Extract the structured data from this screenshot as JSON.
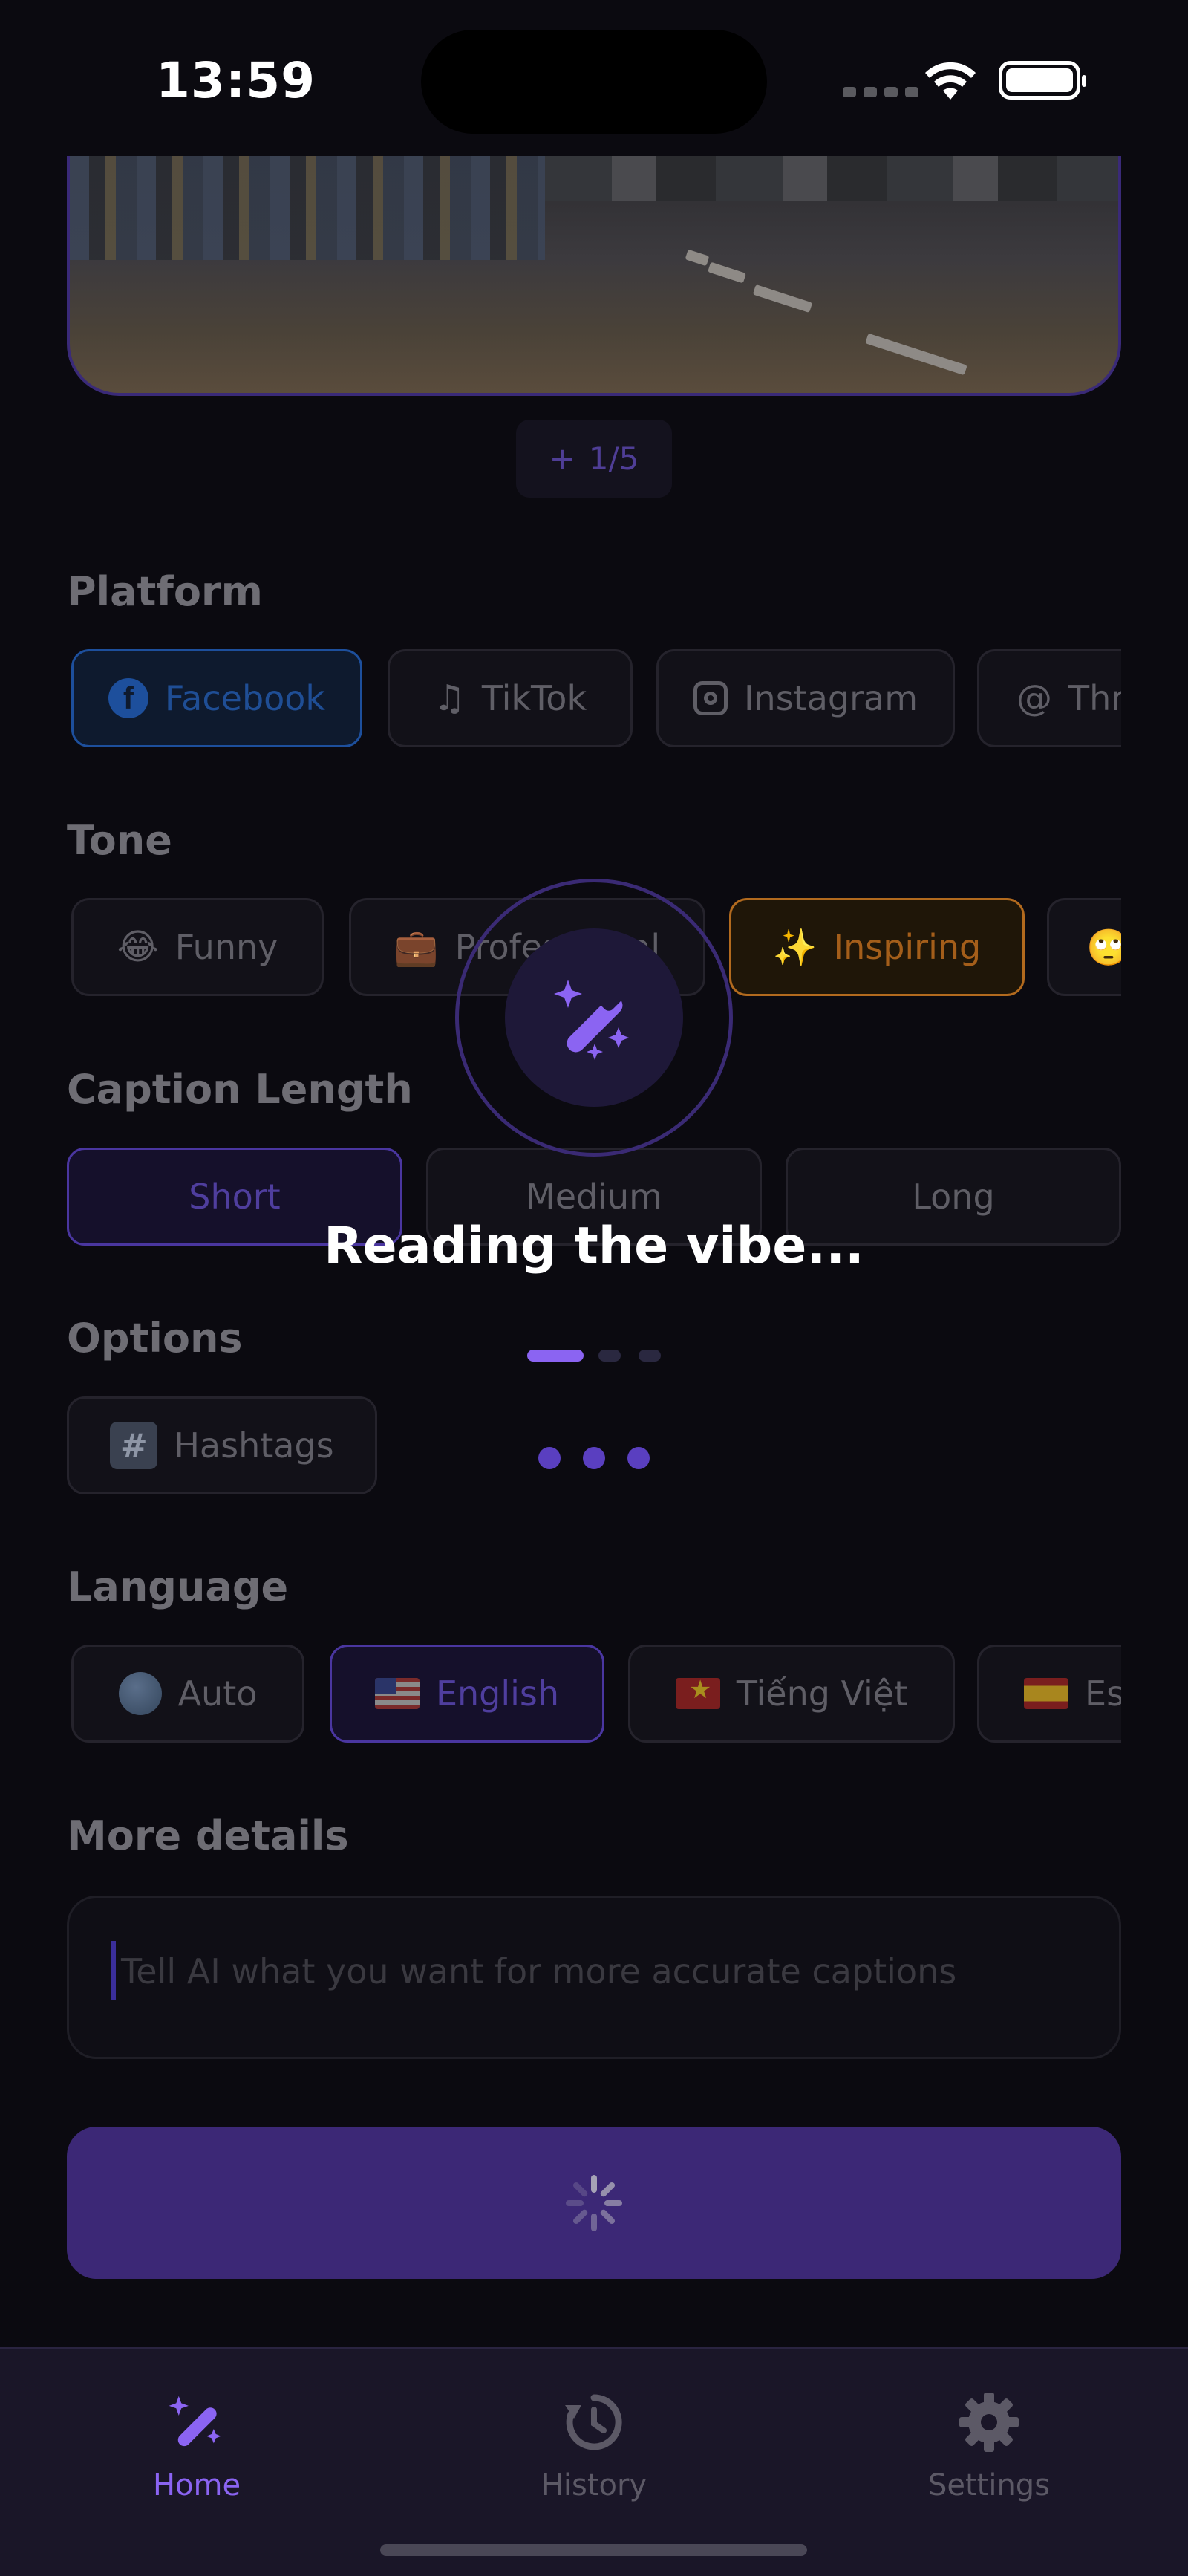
{
  "status_bar": {
    "time": "13:59"
  },
  "photo": {
    "counter": "1/5"
  },
  "sections": {
    "platform": "Platform",
    "tone": "Tone",
    "caption_length": "Caption Length",
    "options": "Options",
    "language": "Language",
    "more_details": "More details"
  },
  "platforms": [
    {
      "label": "Facebook",
      "icon": "facebook-icon",
      "selected": true
    },
    {
      "label": "TikTok",
      "icon": "music-note-icon",
      "selected": false
    },
    {
      "label": "Instagram",
      "icon": "instagram-icon",
      "selected": false
    },
    {
      "label": "Thr",
      "icon": "at-sign-icon",
      "selected": false
    }
  ],
  "tones": [
    {
      "label": "Funny",
      "emoji": "😂",
      "selected": false
    },
    {
      "label": "Professional",
      "emoji": "💼",
      "selected": false
    },
    {
      "label": "Inspiring",
      "emoji": "✨",
      "selected": true
    },
    {
      "label": "",
      "emoji": "🙄",
      "selected": false
    }
  ],
  "lengths": [
    {
      "label": "Short",
      "selected": true
    },
    {
      "label": "Medium",
      "selected": false
    },
    {
      "label": "Long",
      "selected": false
    }
  ],
  "options": [
    {
      "label": "Hashtags",
      "icon": "hash-icon",
      "selected": false
    }
  ],
  "languages": [
    {
      "label": "Auto",
      "icon": "globe-icon",
      "selected": false
    },
    {
      "label": "English",
      "icon": "us-flag-icon",
      "selected": true
    },
    {
      "label": "Tiếng Việt",
      "icon": "vn-flag-icon",
      "selected": false
    },
    {
      "label": "Es",
      "icon": "es-flag-icon",
      "selected": false
    }
  ],
  "details": {
    "placeholder": "Tell AI what you want for more accurate captions"
  },
  "overlay": {
    "message": "Reading the vibe..."
  },
  "tabs": [
    {
      "label": "Home",
      "icon": "magic-wand-icon",
      "active": true
    },
    {
      "label": "History",
      "icon": "history-icon",
      "active": false
    },
    {
      "label": "Settings",
      "icon": "gear-icon",
      "active": false
    }
  ],
  "colors": {
    "accent": "#8b64f2",
    "facebook": "#1d4f9c",
    "inspiring": "#b26a1e",
    "background": "#0b0a10"
  }
}
